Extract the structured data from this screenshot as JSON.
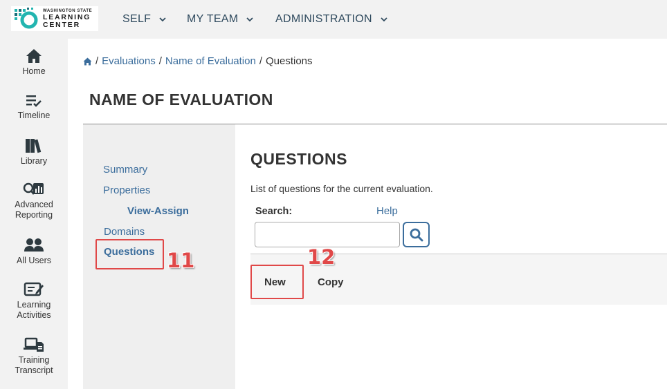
{
  "logo": {
    "small_text": "WASHINGTON STATE",
    "line1": "LEARNING",
    "line2": "CENTER"
  },
  "topnav": [
    {
      "label": "SELF"
    },
    {
      "label": "MY TEAM"
    },
    {
      "label": "ADMINISTRATION"
    }
  ],
  "sidebar": {
    "items": [
      {
        "label": "Home",
        "icon": "home-icon"
      },
      {
        "label": "Timeline",
        "icon": "list-check-icon"
      },
      {
        "label": "Library",
        "icon": "books-icon"
      },
      {
        "label": "Advanced Reporting",
        "icon": "search-chart-icon"
      },
      {
        "label": "All Users",
        "icon": "users-icon"
      },
      {
        "label": "Learning Activities",
        "icon": "edit-list-icon"
      },
      {
        "label": "Training Transcript",
        "icon": "laptop-doc-icon"
      }
    ]
  },
  "breadcrumb": {
    "items": [
      {
        "label": "Evaluations"
      },
      {
        "label": "Name of Evaluation"
      }
    ],
    "current": "Questions",
    "separator": "/"
  },
  "page_title": "NAME OF EVALUATION",
  "subnav": {
    "items": [
      {
        "label": "Summary"
      },
      {
        "label": "Properties"
      },
      {
        "label": "View-Assign"
      },
      {
        "label": "Domains"
      },
      {
        "label": "Questions"
      }
    ]
  },
  "content": {
    "title": "QUESTIONS",
    "description": "List of questions for the current evaluation.",
    "search_label": "Search:",
    "help_label": "Help",
    "search_value": ""
  },
  "toolbar": {
    "new_label": "New",
    "copy_label": "Copy"
  },
  "annotations": {
    "callout_11": "11",
    "callout_12": "12"
  },
  "colors": {
    "link": "#3b6d9c",
    "highlight": "#e04848",
    "nav_text": "#2f4a5e"
  }
}
